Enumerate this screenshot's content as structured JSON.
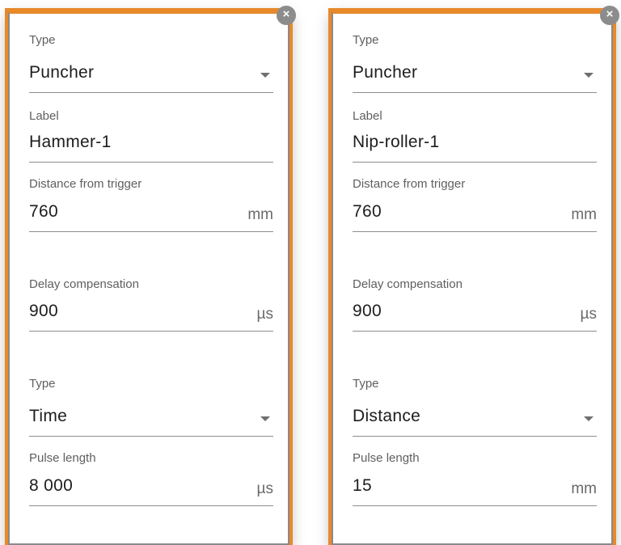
{
  "panels": [
    {
      "close_label": "×",
      "type_label": "Type",
      "type_value": "Puncher",
      "label_label": "Label",
      "label_value": "Hammer-1",
      "distance_label": "Distance from trigger",
      "distance_value": "760",
      "distance_unit": "mm",
      "delay_label": "Delay compensation",
      "delay_value": "900",
      "delay_unit": "µs",
      "pulse_type_label": "Type",
      "pulse_type_value": "Time",
      "pulse_length_label": "Pulse length",
      "pulse_length_value": "8 000",
      "pulse_length_unit": "µs"
    },
    {
      "close_label": "×",
      "type_label": "Type",
      "type_value": "Puncher",
      "label_label": "Label",
      "label_value": "Nip-roller-1",
      "distance_label": "Distance from trigger",
      "distance_value": "760",
      "distance_unit": "mm",
      "delay_label": "Delay compensation",
      "delay_value": "900",
      "delay_unit": "µs",
      "pulse_type_label": "Type",
      "pulse_type_value": "Distance",
      "pulse_length_label": "Pulse length",
      "pulse_length_value": "15",
      "pulse_length_unit": "mm"
    }
  ],
  "colors": {
    "accent": "#e8892b",
    "close_button": "#8c8c8c",
    "underline": "#8d8d8d"
  },
  "icons": {
    "close": "close-icon",
    "dropdown": "chevron-down-icon"
  }
}
